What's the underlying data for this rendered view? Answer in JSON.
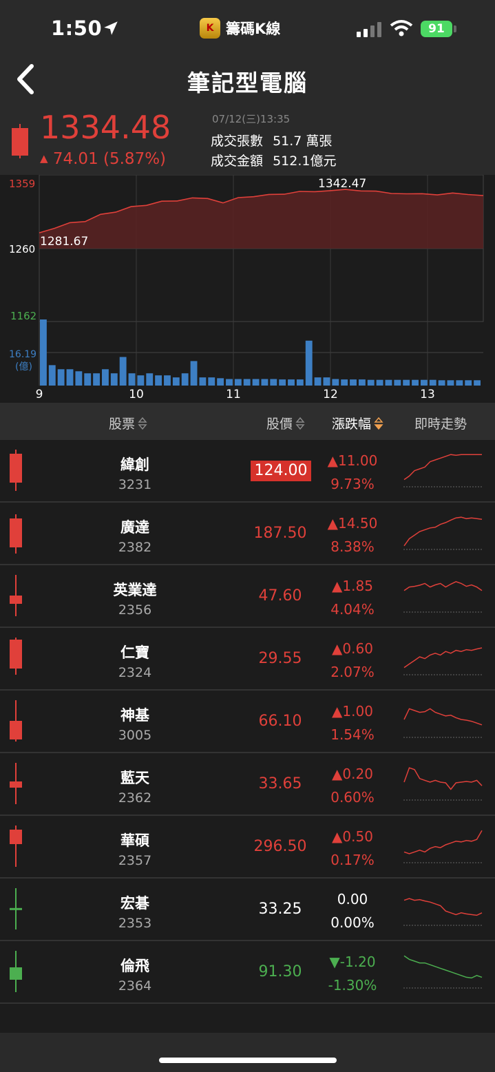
{
  "status": {
    "time": "1:50",
    "app_name": "籌碼K線",
    "app_badge": "K",
    "battery": "91"
  },
  "nav": {
    "title": "筆記型電腦"
  },
  "quote": {
    "price": "1334.48",
    "change": "74.01 (5.87%)",
    "date": "07/12(三)13:35",
    "volume_label": "成交張數",
    "volume_value": "51.7 萬張",
    "amount_label": "成交金額",
    "amount_value": "512.1億元"
  },
  "chart_data": {
    "type": "line",
    "y_top": "1359",
    "y_mid": "1260",
    "y_low": "1162",
    "high_label": "1342.47",
    "low_label": "1281.67",
    "vol_max": "16.19",
    "vol_unit": "(億)",
    "x_ticks": [
      "9",
      "10",
      "11",
      "12",
      "13"
    ],
    "ylim": [
      1162,
      1359
    ],
    "reference": 1260,
    "series": [
      {
        "values": [
          1282,
          1290,
          1295,
          1300,
          1306,
          1312,
          1318,
          1322,
          1325,
          1327,
          1329,
          1331,
          1326,
          1330,
          1333,
          1335,
          1337,
          1338,
          1340,
          1342,
          1342,
          1341,
          1339,
          1338,
          1337,
          1336,
          1336,
          1337,
          1336,
          1334
        ]
      }
    ],
    "volume": [
      16.2,
      5,
      4,
      4,
      3.5,
      3,
      3,
      4,
      3,
      7,
      3,
      2.5,
      3,
      2.5,
      2.5,
      2,
      3,
      6,
      2,
      2,
      1.8,
      1.6,
      1.6,
      1.6,
      1.6,
      1.6,
      1.6,
      1.5,
      1.5,
      1.5,
      11,
      2,
      2,
      1.6,
      1.5,
      1.5,
      1.5,
      1.4,
      1.4,
      1.4,
      1.4,
      1.4,
      1.4,
      1.4,
      1.4,
      1.3,
      1.3,
      1.3,
      1.3,
      1.3
    ]
  },
  "table": {
    "col_stock": "股票",
    "col_price": "股價",
    "col_change": "漲跌幅",
    "col_trend": "即時走勢",
    "rows": [
      {
        "name": "緯創",
        "code": "3231",
        "price": "124.00",
        "change": "▲11.00",
        "pct": "9.73%",
        "color": "red",
        "highlight": true,
        "candle": {
          "body": [
            0.1,
            0.8
          ],
          "wick": [
            0.0,
            1.0
          ],
          "fill": "red"
        },
        "spark": [
          0.2,
          0.3,
          0.45,
          0.5,
          0.55,
          0.7,
          0.75,
          0.8,
          0.85,
          0.9,
          0.88,
          0.9,
          0.9,
          0.9,
          0.9,
          0.9
        ]
      },
      {
        "name": "廣達",
        "code": "2382",
        "price": "187.50",
        "change": "▲14.50",
        "pct": "8.38%",
        "color": "red",
        "highlight": false,
        "candle": {
          "body": [
            0.15,
            0.85
          ],
          "wick": [
            0.05,
            1.0
          ],
          "fill": "red"
        },
        "spark": [
          0.1,
          0.3,
          0.4,
          0.5,
          0.55,
          0.6,
          0.62,
          0.7,
          0.75,
          0.82,
          0.88,
          0.9,
          0.86,
          0.88,
          0.86,
          0.84
        ]
      },
      {
        "name": "英業達",
        "code": "2356",
        "price": "47.60",
        "change": "▲1.85",
        "pct": "4.04%",
        "color": "red",
        "highlight": false,
        "candle": {
          "body": [
            0.5,
            0.7
          ],
          "wick": [
            0.0,
            1.0
          ],
          "fill": "red"
        },
        "spark": [
          0.6,
          0.7,
          0.72,
          0.75,
          0.8,
          0.7,
          0.76,
          0.8,
          0.7,
          0.78,
          0.85,
          0.8,
          0.72,
          0.76,
          0.7,
          0.6
        ]
      },
      {
        "name": "仁寶",
        "code": "2324",
        "price": "29.55",
        "change": "▲0.60",
        "pct": "2.07%",
        "color": "red",
        "highlight": false,
        "candle": {
          "body": [
            0.05,
            0.75
          ],
          "wick": [
            0.0,
            0.9
          ],
          "fill": "red"
        },
        "spark": [
          0.2,
          0.3,
          0.4,
          0.5,
          0.45,
          0.55,
          0.6,
          0.55,
          0.65,
          0.6,
          0.68,
          0.65,
          0.7,
          0.68,
          0.72,
          0.75
        ]
      },
      {
        "name": "神基",
        "code": "3005",
        "price": "66.10",
        "change": "▲1.00",
        "pct": "1.54%",
        "color": "red",
        "highlight": false,
        "candle": {
          "body": [
            0.5,
            0.95
          ],
          "wick": [
            0.0,
            1.0
          ],
          "fill": "red"
        },
        "spark": [
          0.5,
          0.8,
          0.75,
          0.7,
          0.72,
          0.8,
          0.7,
          0.65,
          0.6,
          0.62,
          0.55,
          0.5,
          0.48,
          0.45,
          0.4,
          0.35
        ]
      },
      {
        "name": "藍天",
        "code": "2362",
        "price": "33.65",
        "change": "▲0.20",
        "pct": "0.60%",
        "color": "red",
        "highlight": false,
        "candle": {
          "body": [
            0.45,
            0.6
          ],
          "wick": [
            0.0,
            1.0
          ],
          "fill": "red"
        },
        "spark": [
          0.5,
          0.9,
          0.85,
          0.6,
          0.55,
          0.5,
          0.55,
          0.5,
          0.48,
          0.3,
          0.48,
          0.5,
          0.52,
          0.5,
          0.55,
          0.4
        ]
      },
      {
        "name": "華碩",
        "code": "2357",
        "price": "296.50",
        "change": "▲0.50",
        "pct": "0.17%",
        "color": "red",
        "highlight": false,
        "candle": {
          "body": [
            0.1,
            0.45
          ],
          "wick": [
            0.0,
            1.0
          ],
          "fill": "red"
        },
        "spark": [
          0.3,
          0.25,
          0.3,
          0.35,
          0.3,
          0.4,
          0.45,
          0.42,
          0.5,
          0.55,
          0.6,
          0.58,
          0.62,
          0.6,
          0.65,
          0.9
        ]
      },
      {
        "name": "宏碁",
        "code": "2353",
        "price": "33.25",
        "change": "0.00",
        "pct": "0.00%",
        "color": "white",
        "highlight": false,
        "candle": {
          "body": [
            0.48,
            0.52
          ],
          "wick": [
            0.0,
            1.0
          ],
          "fill": "green"
        },
        "spark": [
          0.7,
          0.75,
          0.7,
          0.72,
          0.68,
          0.65,
          0.6,
          0.55,
          0.4,
          0.35,
          0.3,
          0.35,
          0.32,
          0.3,
          0.28,
          0.35
        ]
      },
      {
        "name": "倫飛",
        "code": "2364",
        "price": "91.30",
        "change": "▼-1.20",
        "pct": "-1.30%",
        "color": "green",
        "highlight": false,
        "candle": {
          "body": [
            0.4,
            0.7
          ],
          "wick": [
            0.0,
            1.0
          ],
          "fill": "green"
        },
        "spark": [
          0.9,
          0.8,
          0.75,
          0.7,
          0.7,
          0.65,
          0.6,
          0.55,
          0.5,
          0.45,
          0.4,
          0.35,
          0.3,
          0.28,
          0.35,
          0.3
        ]
      }
    ]
  },
  "colors": {
    "up": "#e0403a",
    "down": "#4caf50",
    "flat": "#ffffff",
    "volume": "#3d7fc4",
    "sort_active": "#f0a050"
  }
}
